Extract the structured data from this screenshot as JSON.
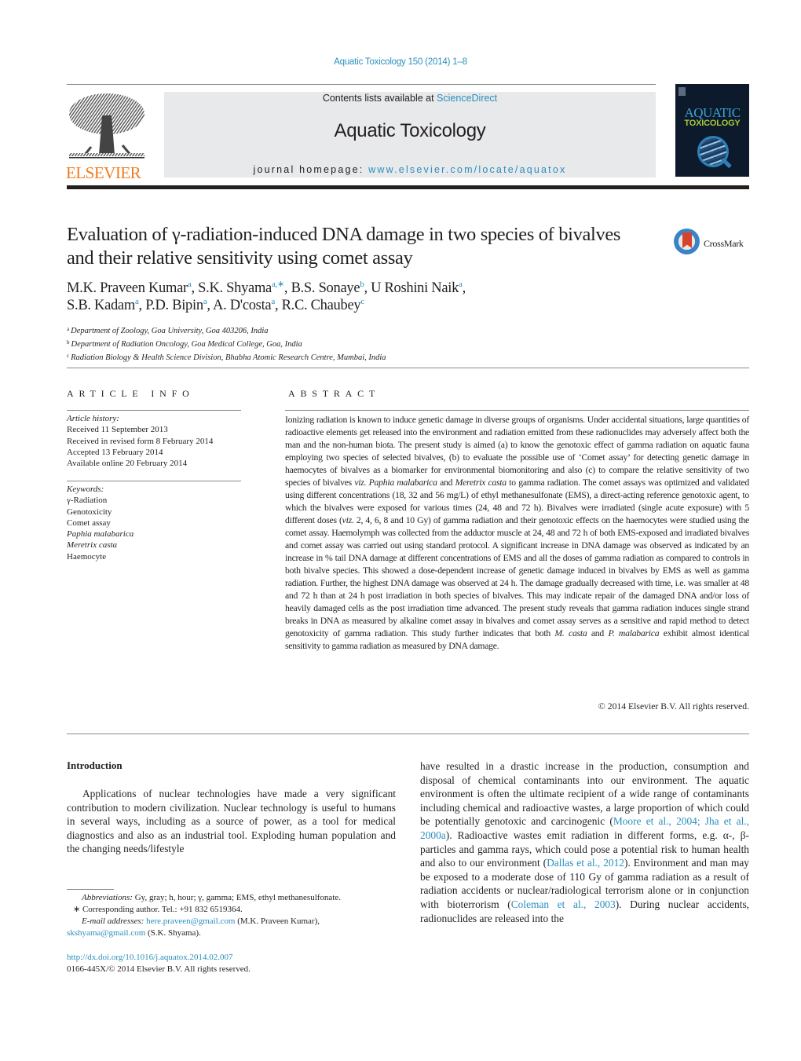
{
  "header": {
    "journal_ref": "Aquatic Toxicology 150 (2014) 1–8",
    "contents_prefix": "Contents lists available at ",
    "contents_link": "ScienceDirect",
    "journal_title": "Aquatic Toxicology",
    "homepage_prefix": "journal homepage: ",
    "homepage_link": "www.elsevier.com/locate/aquatox",
    "publisher_logo_text": "ELSEVIER",
    "cover_title_1": "AQUATIC",
    "cover_title_2": "TOXICOLOGY",
    "crossmark_label": "CrossMark"
  },
  "colors": {
    "link": "#2a8fbd",
    "elsevier_orange": "#f07c1d",
    "masthead_bg": "#e8e9ea",
    "cover_bg": "#0c1a2c"
  },
  "article": {
    "title": "Evaluation of γ-radiation-induced DNA damage in two species of bivalves and their relative sensitivity using comet assay",
    "authors": [
      {
        "name": "M.K. Praveen Kumar",
        "aff": "a"
      },
      {
        "name": "S.K. Shyama",
        "aff": "a,∗"
      },
      {
        "name": "B.S. Sonaye",
        "aff": "b"
      },
      {
        "name": "U Roshini Naik",
        "aff": "a"
      },
      {
        "name": "S.B. Kadam",
        "aff": "a"
      },
      {
        "name": "P.D. Bipin",
        "aff": "a"
      },
      {
        "name": "A. D'costa",
        "aff": "a"
      },
      {
        "name": "R.C. Chaubey",
        "aff": "c"
      }
    ],
    "affiliations": [
      {
        "label": "a",
        "text": "Department of Zoology, Goa University, Goa 403206, India"
      },
      {
        "label": "b",
        "text": "Department of Radiation Oncology, Goa Medical College, Goa, India"
      },
      {
        "label": "c",
        "text": "Radiation Biology & Health Science Division, Bhabha Atomic Research Centre, Mumbai, India"
      }
    ]
  },
  "article_info": {
    "heading": "ARTICLE INFO",
    "history_label": "Article history:",
    "history": [
      "Received 11 September 2013",
      "Received in revised form 8 February 2014",
      "Accepted 13 February 2014",
      "Available online 20 February 2014"
    ],
    "keywords_label": "Keywords:",
    "keywords": [
      {
        "text": "γ-Radiation",
        "italic": false
      },
      {
        "text": "Genotoxicity",
        "italic": false
      },
      {
        "text": "Comet assay",
        "italic": false
      },
      {
        "text": "Paphia malabarica",
        "italic": true
      },
      {
        "text": "Meretrix casta",
        "italic": true
      },
      {
        "text": "Haemocyte",
        "italic": false
      }
    ]
  },
  "abstract": {
    "heading": "ABSTRACT",
    "part1": "Ionizing radiation is known to induce genetic damage in diverse groups of organisms. Under accidental situations, large quantities of radioactive elements get released into the environment and radiation emitted from these radionuclides may adversely affect both the man and the non-human biota. The present study is aimed (a) to know the genotoxic effect of gamma radiation on aquatic fauna employing two species of selected bivalves, (b) to evaluate the possible use of ‘Comet assay’ for detecting genetic damage in haemocytes of bivalves as a biomarker for environmental biomonitoring and also (c) to compare the relative sensitivity of two species of bivalves ",
    "viz1": "viz. Paphia malabarica",
    "and1": " and ",
    "species2": "Meretrix casta",
    "part2": " to gamma radiation. The comet assays was optimized and validated using different concentrations (18, 32 and 56 mg/L) of ethyl methanesulfonate (EMS), a direct-acting reference genotoxic agent, to which the bivalves were exposed for various times (24, 48 and 72 h). Bivalves were irradiated (single acute exposure) with 5 different doses (",
    "viz2": "viz.",
    "part3": " 2, 4, 6, 8 and 10 Gy) of gamma radiation and their genotoxic effects on the haemocytes were studied using the comet assay. Haemolymph was collected from the adductor muscle at 24, 48 and 72 h of both EMS-exposed and irradiated bivalves and comet assay was carried out using standard protocol. A significant increase in DNA damage was observed as indicated by an increase in % tail DNA damage at different concentrations of EMS and all the doses of gamma radiation as compared to controls in both bivalve species. This showed a dose-dependent increase of genetic damage induced in bivalves by EMS as well as gamma radiation. Further, the highest DNA damage was observed at 24 h. The damage gradually decreased with time, i.e. was smaller at 48 and 72 h than at 24 h post irradiation in both species of bivalves. This may indicate repair of the damaged DNA and/or loss of heavily damaged cells as the post irradiation time advanced. The present study reveals that gamma radiation induces single strand breaks in DNA as measured by alkaline comet assay in bivalves and comet assay serves as a sensitive and rapid method to detect genotoxicity of gamma radiation. This study further indicates that both ",
    "species3": "M. casta",
    "and2": " and ",
    "species4": "P. malabarica",
    "part4": " exhibit almost identical sensitivity to gamma radiation as measured by DNA damage.",
    "copyright": "© 2014 Elsevier B.V. All rights reserved."
  },
  "body": {
    "intro_heading": "Introduction",
    "left_para": "Applications of nuclear technologies have made a very significant contribution to modern civilization. Nuclear technology is useful to humans in several ways, including as a source of power, as a tool for medical diagnostics and also as an industrial tool. Exploding human population and the changing needs/lifestyle",
    "right_1": "have resulted in a drastic increase in the production, consumption and disposal of chemical contaminants into our environment. The aquatic environment is often the ultimate recipient of a wide range of contaminants including chemical and radioactive wastes, a large proportion of which could be potentially genotoxic and carcinogenic (",
    "cite_1": "Moore et al., 2004; Jha et al., 2000a",
    "right_2": "). Radioactive wastes emit radiation in different forms, e.g. α-, β-particles and gamma rays, which could pose a potential risk to human health and also to our environment (",
    "cite_2": "Dallas et al., 2012",
    "right_3": "). Environment and man may be exposed to a moderate dose of 110 Gy of gamma radiation as a result of radiation accidents or nuclear/radiological terrorism alone or in conjunction with bioterrorism (",
    "cite_3": "Coleman et al., 2003",
    "right_4": "). During nuclear accidents, radionuclides are released into the"
  },
  "footnotes": {
    "abbr_label": "Abbreviations:",
    "abbr_text": "  Gy, gray; h, hour; γ, gamma; EMS, ethyl methanesulfonate.",
    "corr_mark": "∗",
    "corr_text": " Corresponding author. Tel.: +91 832 6519364.",
    "email_label": "E-mail addresses:",
    "email_1": "here.praveen@gmail.com",
    "email_1_owner": " (M.K. Praveen Kumar),",
    "email_2": "skshyama@gmail.com",
    "email_2_owner": " (S.K. Shyama).",
    "doi": "http://dx.doi.org/10.1016/j.aquatox.2014.02.007",
    "issn_line": "0166-445X/© 2014 Elsevier B.V. All rights reserved."
  }
}
